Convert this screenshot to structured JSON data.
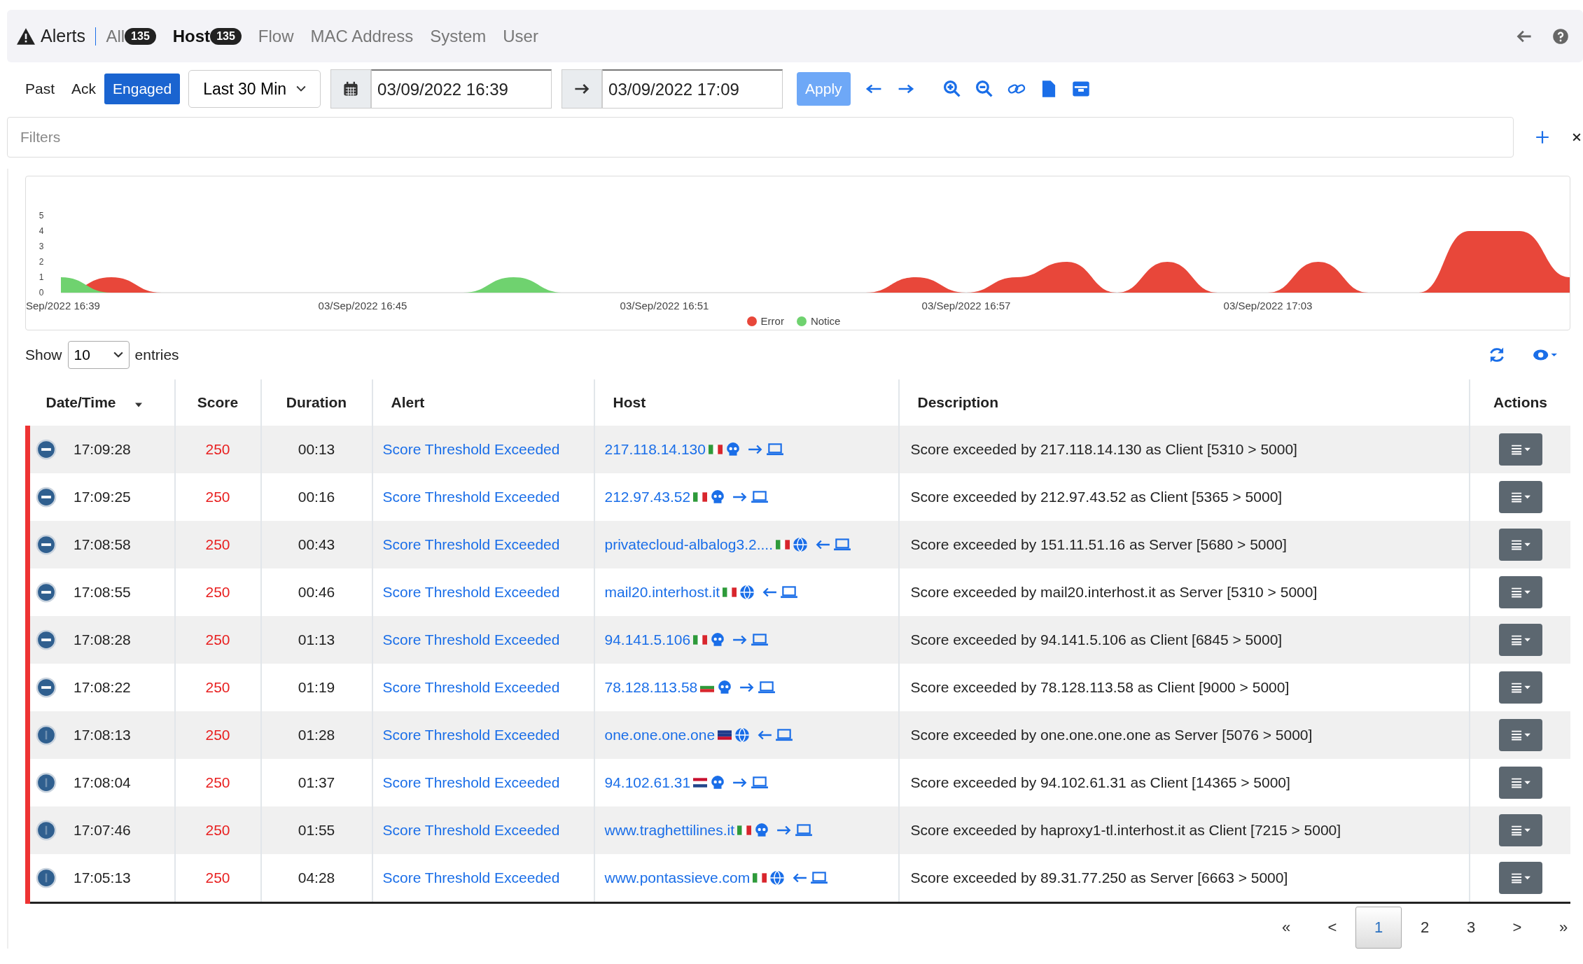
{
  "nav": {
    "title": "Alerts",
    "tabs": [
      {
        "label": "All",
        "count": "135",
        "selected": false
      },
      {
        "label": "Host",
        "count": "135",
        "selected": true
      },
      {
        "label": "Flow",
        "selected": false
      },
      {
        "label": "MAC Address",
        "selected": false
      },
      {
        "label": "System",
        "selected": false
      },
      {
        "label": "User",
        "selected": false
      }
    ]
  },
  "toolbar": {
    "status_tabs": [
      {
        "label": "Past",
        "selected": false
      },
      {
        "label": "Ack",
        "selected": false
      },
      {
        "label": "Engaged",
        "selected": true
      }
    ],
    "range": "Last 30 Min",
    "from": "03/09/2022 16:39",
    "to": "03/09/2022 17:09",
    "apply": "Apply"
  },
  "filters": {
    "placeholder": "Filters"
  },
  "chart": {
    "chart_data": {
      "type": "area",
      "categories": [
        "Sep/2022 16:39",
        null,
        null,
        null,
        null,
        null,
        "03/Sep/2022 16:45",
        null,
        null,
        null,
        null,
        null,
        "03/Sep/2022 16:51",
        null,
        null,
        null,
        null,
        null,
        "03/Sep/2022 16:57",
        null,
        null,
        null,
        null,
        null,
        "03/Sep/2022 17:03",
        null,
        null,
        null,
        null,
        null,
        null
      ],
      "yticks": [
        0,
        1,
        2,
        3,
        4,
        5
      ],
      "ylim": [
        0,
        5
      ],
      "legend": "bottom",
      "series": [
        {
          "name": "Error",
          "color": "#e8473a",
          "values": [
            0,
            1,
            0,
            0,
            0,
            0,
            0,
            0,
            0,
            0,
            0,
            0,
            0,
            0,
            0,
            0,
            0,
            1,
            0,
            1,
            2,
            0,
            2,
            0,
            0,
            2,
            0,
            0,
            4,
            4,
            1
          ]
        },
        {
          "name": "Notice",
          "color": "#6fd26f",
          "values": [
            1,
            0,
            0,
            0,
            0,
            0,
            0,
            0,
            0,
            1,
            0,
            0,
            0,
            0,
            0,
            0,
            0,
            0,
            0,
            0,
            0,
            0,
            0,
            0,
            0,
            0,
            0,
            0,
            0,
            0,
            0
          ]
        }
      ]
    }
  },
  "table": {
    "show_label": "Show",
    "page_size": "10",
    "entries_label": "entries",
    "columns": [
      "Date/Time",
      "Score",
      "Duration",
      "Alert",
      "Host",
      "Description",
      "Actions"
    ],
    "rows": [
      {
        "status": {
          "kind": "minus"
        },
        "time": "17:09:28",
        "score": "250",
        "duration": "00:13",
        "alert": "Score Threshold Exceeded",
        "host": "217.118.14.130",
        "flag": {
          "kind": "it"
        },
        "peer": {
          "kind": "skull"
        },
        "arrow": {
          "kind": "right"
        },
        "description": "Score exceeded by 217.118.14.130 as Client [5310 > 5000]"
      },
      {
        "status": {
          "kind": "minus"
        },
        "time": "17:09:25",
        "score": "250",
        "duration": "00:16",
        "alert": "Score Threshold Exceeded",
        "host": "212.97.43.52",
        "flag": {
          "kind": "it"
        },
        "peer": {
          "kind": "skull"
        },
        "arrow": {
          "kind": "right"
        },
        "description": "Score exceeded by 212.97.43.52 as Client [5365 > 5000]"
      },
      {
        "status": {
          "kind": "minus"
        },
        "time": "17:08:58",
        "score": "250",
        "duration": "00:43",
        "alert": "Score Threshold Exceeded",
        "host": "privatecloud-albalog3.2....",
        "flag": {
          "kind": "it"
        },
        "peer": {
          "kind": "globe"
        },
        "arrow": {
          "kind": "left"
        },
        "description": "Score exceeded by 151.11.51.16 as Server [5680 > 5000]"
      },
      {
        "status": {
          "kind": "minus"
        },
        "time": "17:08:55",
        "score": "250",
        "duration": "00:46",
        "alert": "Score Threshold Exceeded",
        "host": "mail20.interhost.it",
        "flag": {
          "kind": "it"
        },
        "peer": {
          "kind": "globe"
        },
        "arrow": {
          "kind": "left"
        },
        "description": "Score exceeded by mail20.interhost.it as Server [5310 > 5000]"
      },
      {
        "status": {
          "kind": "minus"
        },
        "time": "17:08:28",
        "score": "250",
        "duration": "01:13",
        "alert": "Score Threshold Exceeded",
        "host": "94.141.5.106",
        "flag": {
          "kind": "it"
        },
        "peer": {
          "kind": "skull"
        },
        "arrow": {
          "kind": "right"
        },
        "description": "Score exceeded by 94.141.5.106 as Client [6845 > 5000]"
      },
      {
        "status": {
          "kind": "minus"
        },
        "time": "17:08:22",
        "score": "250",
        "duration": "01:19",
        "alert": "Score Threshold Exceeded",
        "host": "78.128.113.58",
        "flag": {
          "kind": "bg"
        },
        "peer": {
          "kind": "skull"
        },
        "arrow": {
          "kind": "right"
        },
        "description": "Score exceeded by 78.128.113.58 as Client [9000 > 5000]"
      },
      {
        "status": {
          "kind": "dot"
        },
        "time": "17:08:13",
        "score": "250",
        "duration": "01:28",
        "alert": "Score Threshold Exceeded",
        "host": "one.one.one.one",
        "flag": {
          "kind": "au"
        },
        "peer": {
          "kind": "globe"
        },
        "arrow": {
          "kind": "left"
        },
        "description": "Score exceeded by one.one.one.one as Server [5076 > 5000]"
      },
      {
        "status": {
          "kind": "dot"
        },
        "time": "17:08:04",
        "score": "250",
        "duration": "01:37",
        "alert": "Score Threshold Exceeded",
        "host": "94.102.61.31",
        "flag": {
          "kind": "nl"
        },
        "peer": {
          "kind": "skull"
        },
        "arrow": {
          "kind": "right"
        },
        "description": "Score exceeded by 94.102.61.31 as Client [14365 > 5000]"
      },
      {
        "status": {
          "kind": "dot"
        },
        "time": "17:07:46",
        "score": "250",
        "duration": "01:55",
        "alert": "Score Threshold Exceeded",
        "host": "www.traghettilines.it",
        "flag": {
          "kind": "it"
        },
        "peer": {
          "kind": "skull"
        },
        "arrow": {
          "kind": "right"
        },
        "description": "Score exceeded by haproxy1-tl.interhost.it as Client [7215 > 5000]"
      },
      {
        "status": {
          "kind": "dot"
        },
        "time": "17:05:13",
        "score": "250",
        "duration": "04:28",
        "alert": "Score Threshold Exceeded",
        "host": "www.pontassieve.com",
        "flag": {
          "kind": "it"
        },
        "peer": {
          "kind": "globe"
        },
        "arrow": {
          "kind": "left"
        },
        "description": "Score exceeded by 89.31.77.250 as Server [6663 > 5000]"
      }
    ],
    "pagination": [
      {
        "label": "«",
        "selected": false
      },
      {
        "label": "<",
        "selected": false
      },
      {
        "label": "1",
        "selected": true
      },
      {
        "label": "2",
        "selected": false
      },
      {
        "label": "3",
        "selected": false
      },
      {
        "label": ">",
        "selected": false
      },
      {
        "label": "»",
        "selected": false
      }
    ]
  }
}
